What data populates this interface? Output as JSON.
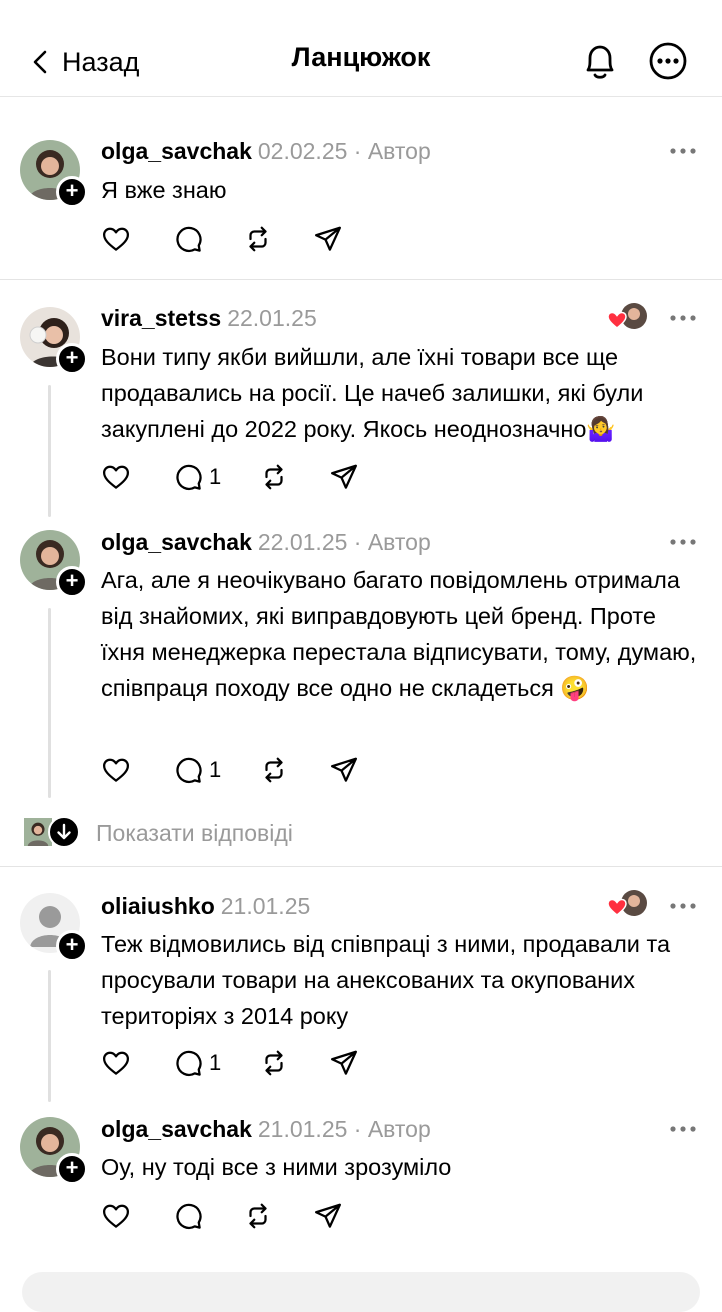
{
  "header": {
    "back_label": "Назад",
    "title": "Ланцюжок"
  },
  "show_replies_label": "Показати відповіді",
  "colors": {
    "heart_red": "#ff3040",
    "muted": "#9a9a9a"
  },
  "posts": [
    {
      "username": "olga_savchak",
      "date": "02.02.25",
      "author_tag": "· Автор",
      "text": "Я вже знаю",
      "reply_count": "",
      "liked_by_author": false
    },
    {
      "username": "vira_stetss",
      "date": "22.01.25",
      "author_tag": "",
      "text": "Вони типу якби вийшли, але їхні товари все ще продавались на росії. Це начеб залишки, які були закуплені до 2022 року. Якось неоднозначно🤷‍♀️",
      "reply_count": "1",
      "liked_by_author": true
    },
    {
      "username": "olga_savchak",
      "date": "22.01.25",
      "author_tag": "· Автор",
      "text": "Ага, але я неочікувано багато повідомлень отримала від знайомих, які виправдовують цей бренд. Проте їхня менеджерка перестала відписувати, тому, думаю, співпраця походу все одно не складеться 🤪",
      "reply_count": "1",
      "liked_by_author": false
    },
    {
      "username": "oliaiushko",
      "date": "21.01.25",
      "author_tag": "",
      "text": "Теж відмовились від співпраці з ними, продавали та просували товари на анексованих та окупованих територіях з 2014 року",
      "reply_count": "1",
      "liked_by_author": true
    },
    {
      "username": "olga_savchak",
      "date": "21.01.25",
      "author_tag": "· Автор",
      "text": "Оу, ну тоді все з ними зрозуміло",
      "reply_count": "",
      "liked_by_author": false
    }
  ]
}
